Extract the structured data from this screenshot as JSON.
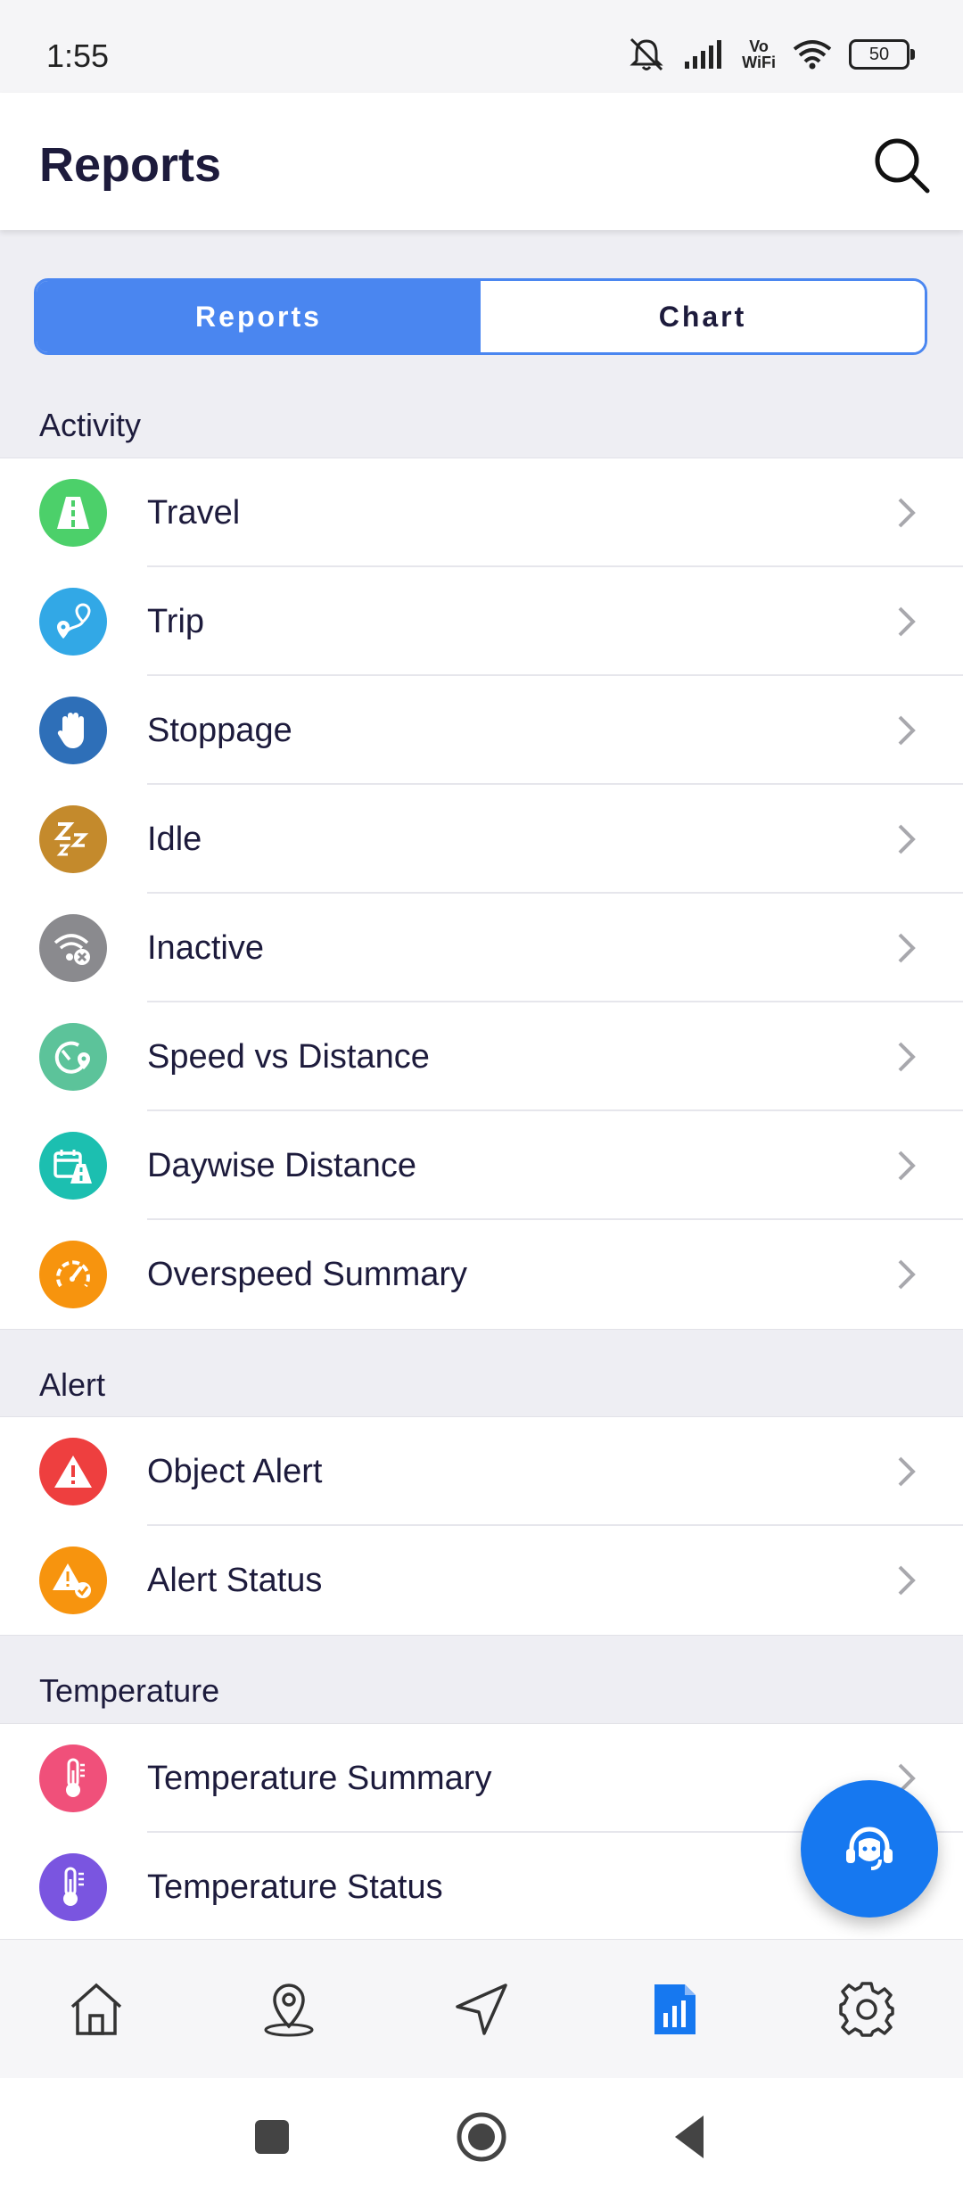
{
  "status": {
    "time": "1:55",
    "vowifi_top": "Vo",
    "vowifi_bottom": "WiFi",
    "battery": "50"
  },
  "appbar": {
    "title": "Reports"
  },
  "segment": {
    "tab_reports": "Reports",
    "tab_chart": "Chart",
    "active": "Reports"
  },
  "sections": {
    "activity": {
      "title": "Activity",
      "items": [
        {
          "label": "Travel",
          "icon": "road-icon",
          "color": "#4cd06a"
        },
        {
          "label": "Trip",
          "icon": "route-pin-icon",
          "color": "#32a8e6"
        },
        {
          "label": "Stoppage",
          "icon": "hand-stop-icon",
          "color": "#2e6fb8"
        },
        {
          "label": "Idle",
          "icon": "sleep-zzz-icon",
          "color": "#c48a2c"
        },
        {
          "label": "Inactive",
          "icon": "wifi-off-icon",
          "color": "#8a8a8e"
        },
        {
          "label": "Speed vs Distance",
          "icon": "speed-distance-icon",
          "color": "#5cc39a"
        },
        {
          "label": "Daywise Distance",
          "icon": "calendar-road-icon",
          "color": "#1cbfb0"
        },
        {
          "label": "Overspeed Summary",
          "icon": "speedometer-icon",
          "color": "#f7940e"
        }
      ]
    },
    "alert": {
      "title": "Alert",
      "items": [
        {
          "label": "Object Alert",
          "icon": "warning-icon",
          "color": "#ee3f3f"
        },
        {
          "label": "Alert Status",
          "icon": "warning-check-icon",
          "color": "#f7940e"
        }
      ]
    },
    "temperature": {
      "title": "Temperature",
      "items": [
        {
          "label": "Temperature Summary",
          "icon": "thermometer-icon",
          "color": "#f0507a"
        },
        {
          "label": "Temperature Status",
          "icon": "thermometer-status-icon",
          "color": "#7a55e0"
        }
      ]
    }
  },
  "colors": {
    "accent": "#4a86f0",
    "fab": "#1678f0",
    "nav_active": "#1678f0"
  },
  "bottom_nav": [
    "home-icon",
    "location-pin-icon",
    "navigate-icon",
    "reports-icon",
    "settings-icon"
  ],
  "active_nav": "reports-icon"
}
